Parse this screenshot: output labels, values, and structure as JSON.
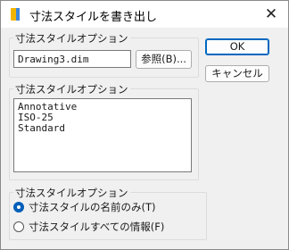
{
  "window": {
    "title": "寸法スタイルを書き出し",
    "close_label": "✕"
  },
  "file_group": {
    "legend": "寸法スタイルオプション",
    "filename_value": "Drawing3.dim",
    "browse_label": "参照(B)..."
  },
  "buttons": {
    "ok_label": "OK",
    "cancel_label": "キャンセル"
  },
  "list_group": {
    "legend": "寸法スタイルオプション",
    "items": [
      "Annotative",
      "ISO-25",
      "Standard"
    ]
  },
  "options_group": {
    "legend": "寸法スタイルオプション",
    "options": [
      {
        "label": "寸法スタイルの名前のみ(T)",
        "checked": true
      },
      {
        "label": "寸法スタイルすべての情報(F)",
        "checked": false
      }
    ]
  }
}
